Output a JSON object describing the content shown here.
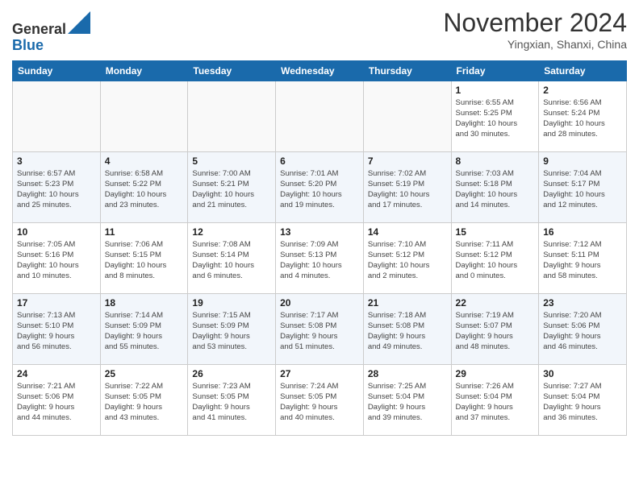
{
  "header": {
    "logo_line1": "General",
    "logo_line2": "Blue",
    "month": "November 2024",
    "location": "Yingxian, Shanxi, China"
  },
  "weekdays": [
    "Sunday",
    "Monday",
    "Tuesday",
    "Wednesday",
    "Thursday",
    "Friday",
    "Saturday"
  ],
  "weeks": [
    [
      {
        "day": "",
        "info": ""
      },
      {
        "day": "",
        "info": ""
      },
      {
        "day": "",
        "info": ""
      },
      {
        "day": "",
        "info": ""
      },
      {
        "day": "",
        "info": ""
      },
      {
        "day": "1",
        "info": "Sunrise: 6:55 AM\nSunset: 5:25 PM\nDaylight: 10 hours\nand 30 minutes."
      },
      {
        "day": "2",
        "info": "Sunrise: 6:56 AM\nSunset: 5:24 PM\nDaylight: 10 hours\nand 28 minutes."
      }
    ],
    [
      {
        "day": "3",
        "info": "Sunrise: 6:57 AM\nSunset: 5:23 PM\nDaylight: 10 hours\nand 25 minutes."
      },
      {
        "day": "4",
        "info": "Sunrise: 6:58 AM\nSunset: 5:22 PM\nDaylight: 10 hours\nand 23 minutes."
      },
      {
        "day": "5",
        "info": "Sunrise: 7:00 AM\nSunset: 5:21 PM\nDaylight: 10 hours\nand 21 minutes."
      },
      {
        "day": "6",
        "info": "Sunrise: 7:01 AM\nSunset: 5:20 PM\nDaylight: 10 hours\nand 19 minutes."
      },
      {
        "day": "7",
        "info": "Sunrise: 7:02 AM\nSunset: 5:19 PM\nDaylight: 10 hours\nand 17 minutes."
      },
      {
        "day": "8",
        "info": "Sunrise: 7:03 AM\nSunset: 5:18 PM\nDaylight: 10 hours\nand 14 minutes."
      },
      {
        "day": "9",
        "info": "Sunrise: 7:04 AM\nSunset: 5:17 PM\nDaylight: 10 hours\nand 12 minutes."
      }
    ],
    [
      {
        "day": "10",
        "info": "Sunrise: 7:05 AM\nSunset: 5:16 PM\nDaylight: 10 hours\nand 10 minutes."
      },
      {
        "day": "11",
        "info": "Sunrise: 7:06 AM\nSunset: 5:15 PM\nDaylight: 10 hours\nand 8 minutes."
      },
      {
        "day": "12",
        "info": "Sunrise: 7:08 AM\nSunset: 5:14 PM\nDaylight: 10 hours\nand 6 minutes."
      },
      {
        "day": "13",
        "info": "Sunrise: 7:09 AM\nSunset: 5:13 PM\nDaylight: 10 hours\nand 4 minutes."
      },
      {
        "day": "14",
        "info": "Sunrise: 7:10 AM\nSunset: 5:12 PM\nDaylight: 10 hours\nand 2 minutes."
      },
      {
        "day": "15",
        "info": "Sunrise: 7:11 AM\nSunset: 5:12 PM\nDaylight: 10 hours\nand 0 minutes."
      },
      {
        "day": "16",
        "info": "Sunrise: 7:12 AM\nSunset: 5:11 PM\nDaylight: 9 hours\nand 58 minutes."
      }
    ],
    [
      {
        "day": "17",
        "info": "Sunrise: 7:13 AM\nSunset: 5:10 PM\nDaylight: 9 hours\nand 56 minutes."
      },
      {
        "day": "18",
        "info": "Sunrise: 7:14 AM\nSunset: 5:09 PM\nDaylight: 9 hours\nand 55 minutes."
      },
      {
        "day": "19",
        "info": "Sunrise: 7:15 AM\nSunset: 5:09 PM\nDaylight: 9 hours\nand 53 minutes."
      },
      {
        "day": "20",
        "info": "Sunrise: 7:17 AM\nSunset: 5:08 PM\nDaylight: 9 hours\nand 51 minutes."
      },
      {
        "day": "21",
        "info": "Sunrise: 7:18 AM\nSunset: 5:08 PM\nDaylight: 9 hours\nand 49 minutes."
      },
      {
        "day": "22",
        "info": "Sunrise: 7:19 AM\nSunset: 5:07 PM\nDaylight: 9 hours\nand 48 minutes."
      },
      {
        "day": "23",
        "info": "Sunrise: 7:20 AM\nSunset: 5:06 PM\nDaylight: 9 hours\nand 46 minutes."
      }
    ],
    [
      {
        "day": "24",
        "info": "Sunrise: 7:21 AM\nSunset: 5:06 PM\nDaylight: 9 hours\nand 44 minutes."
      },
      {
        "day": "25",
        "info": "Sunrise: 7:22 AM\nSunset: 5:05 PM\nDaylight: 9 hours\nand 43 minutes."
      },
      {
        "day": "26",
        "info": "Sunrise: 7:23 AM\nSunset: 5:05 PM\nDaylight: 9 hours\nand 41 minutes."
      },
      {
        "day": "27",
        "info": "Sunrise: 7:24 AM\nSunset: 5:05 PM\nDaylight: 9 hours\nand 40 minutes."
      },
      {
        "day": "28",
        "info": "Sunrise: 7:25 AM\nSunset: 5:04 PM\nDaylight: 9 hours\nand 39 minutes."
      },
      {
        "day": "29",
        "info": "Sunrise: 7:26 AM\nSunset: 5:04 PM\nDaylight: 9 hours\nand 37 minutes."
      },
      {
        "day": "30",
        "info": "Sunrise: 7:27 AM\nSunset: 5:04 PM\nDaylight: 9 hours\nand 36 minutes."
      }
    ]
  ]
}
